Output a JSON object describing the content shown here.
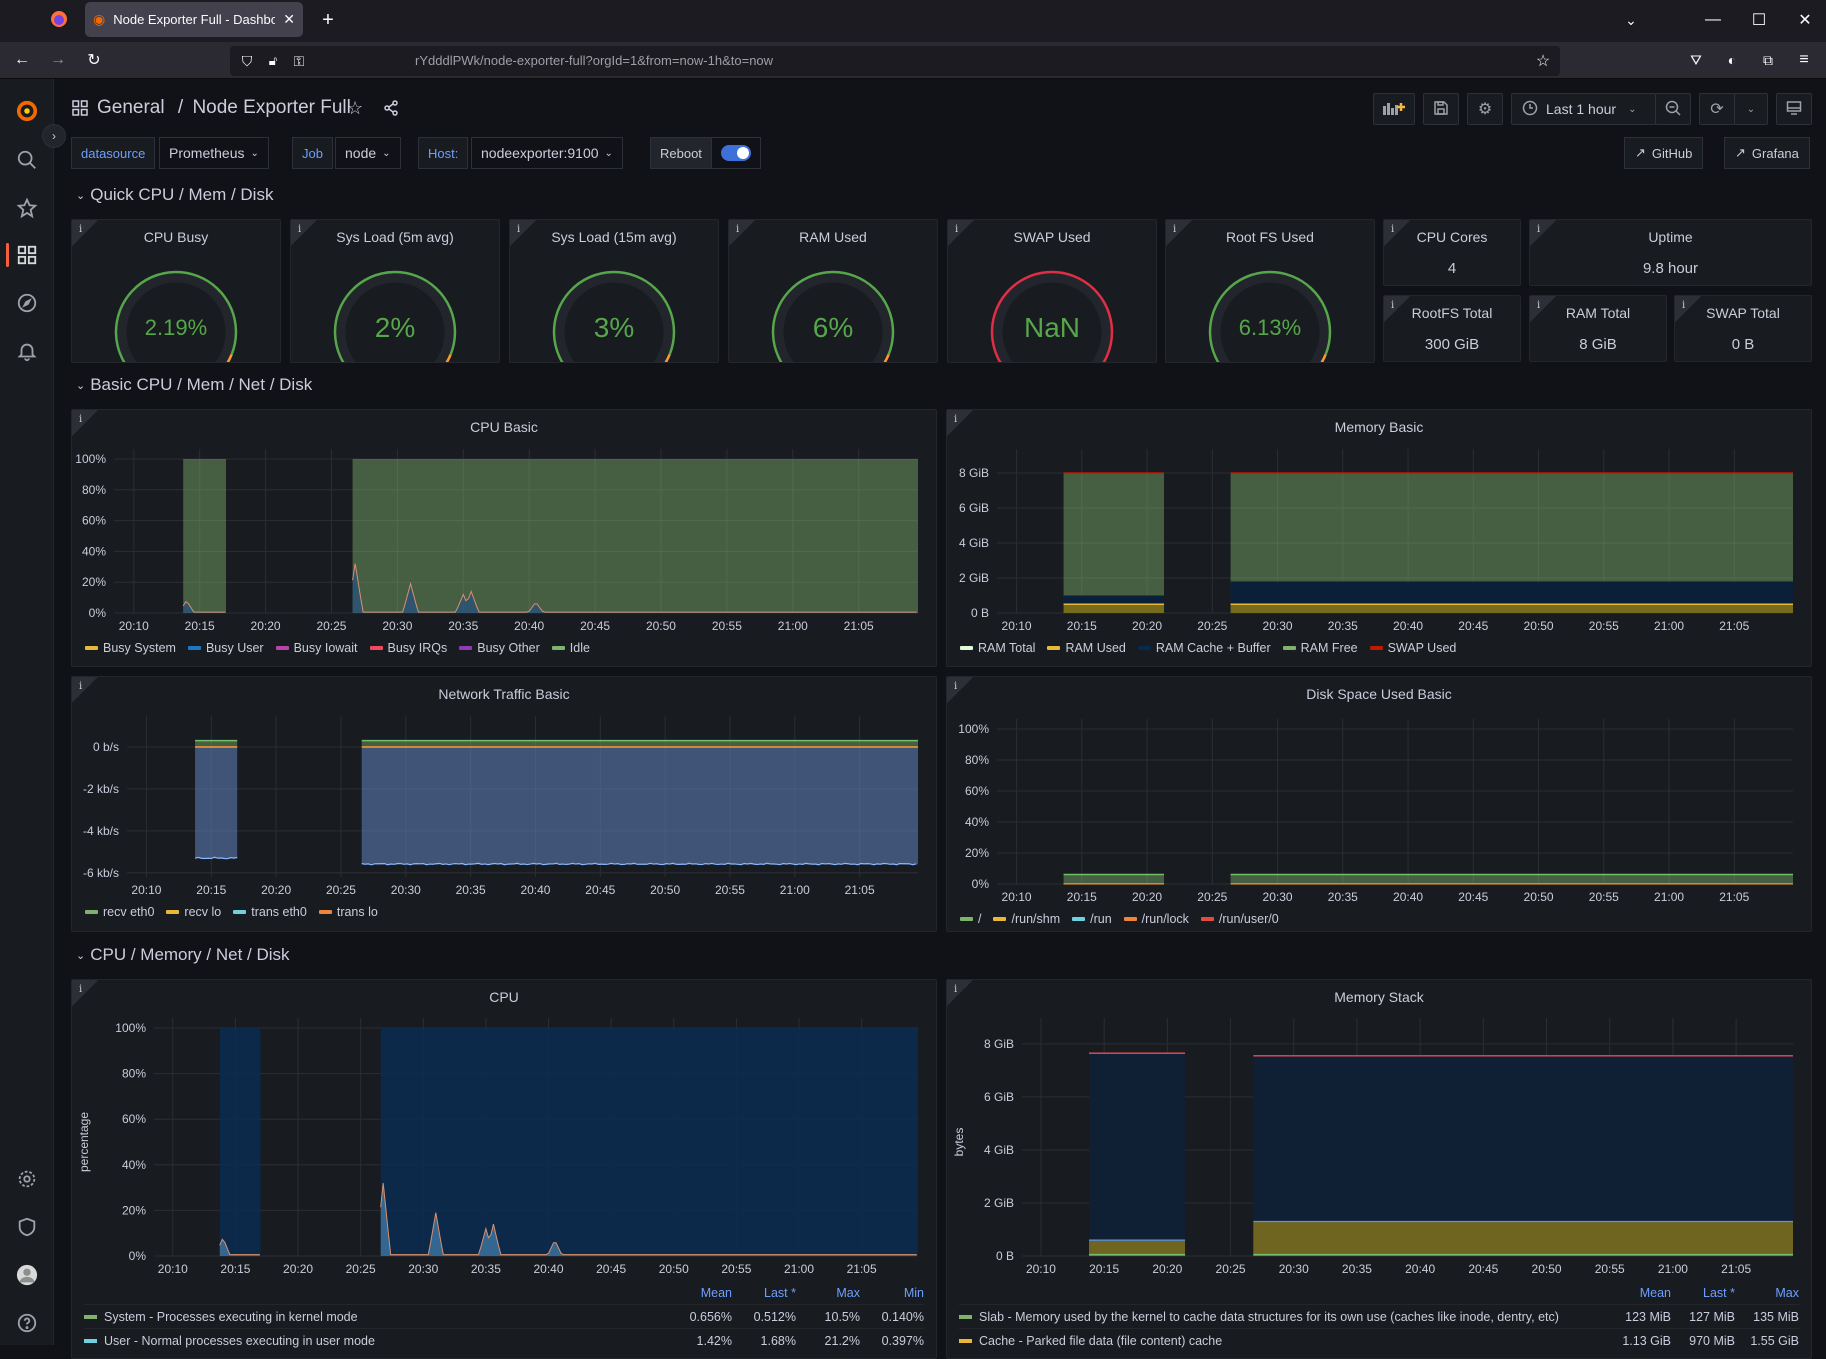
{
  "browser": {
    "tab_title": "Node Exporter Full - Dashboard",
    "url": "rYdddlPWk/node-exporter-full?orgId=1&from=now-1h&to=now"
  },
  "header": {
    "breadcrumb_folder": "General",
    "breadcrumb_sep": "/",
    "dashboard_title": "Node Exporter Full",
    "time_range": "Last 1 hour"
  },
  "variables": [
    {
      "label": "datasource",
      "value": "Prometheus"
    },
    {
      "label": "Job",
      "value": "node"
    },
    {
      "label": "Host:",
      "value": "nodeexporter:9100"
    }
  ],
  "reboot_label": "Reboot",
  "reboot_toggle_on": true,
  "links": [
    {
      "label": "GitHub"
    },
    {
      "label": "Grafana"
    }
  ],
  "rows": [
    "Quick CPU / Mem / Disk",
    "Basic CPU / Mem / Net / Disk",
    "CPU / Memory / Net / Disk"
  ],
  "gauges": [
    {
      "title": "CPU Busy",
      "value": "2.19%",
      "percent": 2.19,
      "thresholds": "green-orange-red"
    },
    {
      "title": "Sys Load (5m avg)",
      "value": "2%",
      "percent": 2,
      "thresholds": "green-orange-red"
    },
    {
      "title": "Sys Load (15m avg)",
      "value": "3%",
      "percent": 3,
      "thresholds": "green-orange-red"
    },
    {
      "title": "RAM Used",
      "value": "6%",
      "percent": 6,
      "thresholds": "green-orange-red"
    },
    {
      "title": "SWAP Used",
      "value": "NaN",
      "percent": 0,
      "thresholds": "green-orange-red-heavy"
    },
    {
      "title": "Root FS Used",
      "value": "6.13%",
      "percent": 6.13,
      "thresholds": "green-orange-red"
    }
  ],
  "stats": [
    {
      "title": "CPU Cores",
      "value": "4"
    },
    {
      "title": "Uptime",
      "value": "9.8 hour"
    },
    {
      "title": "RootFS Total",
      "value": "300 GiB"
    },
    {
      "title": "RAM Total",
      "value": "8 GiB"
    },
    {
      "title": "SWAP Total",
      "value": "0 B"
    }
  ],
  "chart_data": [
    {
      "type": "area",
      "title": "CPU Basic",
      "x": [
        "20:10",
        "20:15",
        "20:20",
        "20:25",
        "20:30",
        "20:35",
        "20:40",
        "20:45",
        "20:50",
        "20:55",
        "21:00",
        "21:05"
      ],
      "yticks": [
        "0%",
        "20%",
        "40%",
        "60%",
        "80%",
        "100%"
      ],
      "ylim": [
        0,
        100
      ],
      "gaps": [
        [
          "20:13:45",
          "20:17:00"
        ],
        [
          "20:26:40",
          "21:09:30"
        ]
      ],
      "series": [
        {
          "name": "Busy System",
          "color": "#EAB839"
        },
        {
          "name": "Busy User",
          "color": "#1F78C1"
        },
        {
          "name": "Busy Iowait",
          "color": "#BA43A9"
        },
        {
          "name": "Busy IRQs",
          "color": "#F2495C"
        },
        {
          "name": "Busy Other",
          "color": "#8F3BB8"
        },
        {
          "name": "Idle",
          "color": "#7EB26D"
        }
      ],
      "spikes": [
        [
          20.45,
          8
        ],
        [
          26.8,
          32
        ],
        [
          31,
          19
        ],
        [
          35,
          12
        ],
        [
          35.6,
          14
        ],
        [
          40.5,
          7
        ]
      ]
    },
    {
      "type": "area",
      "title": "Memory Basic",
      "x": [
        "20:10",
        "20:15",
        "20:20",
        "20:25",
        "20:30",
        "20:35",
        "20:40",
        "20:45",
        "20:50",
        "20:55",
        "21:00",
        "21:05"
      ],
      "yticks": [
        "0 B",
        "2 GiB",
        "4 GiB",
        "6 GiB",
        "8 GiB"
      ],
      "ylim": [
        0,
        8.8
      ],
      "series": [
        {
          "name": "RAM Total",
          "color": "#E0F9D7"
        },
        {
          "name": "RAM Used",
          "color": "#EAB839"
        },
        {
          "name": "RAM Cache + Buffer",
          "color": "#052B51"
        },
        {
          "name": "RAM Free",
          "color": "#7EB26D"
        },
        {
          "name": "SWAP Used",
          "color": "#BF1B00"
        }
      ]
    },
    {
      "type": "area",
      "title": "Network Traffic Basic",
      "x": [
        "20:10",
        "20:15",
        "20:20",
        "20:25",
        "20:30",
        "20:35",
        "20:40",
        "20:45",
        "20:50",
        "20:55",
        "21:00",
        "21:05"
      ],
      "yticks": [
        "-6 kb/s",
        "-4 kb/s",
        "-2 kb/s",
        "0 b/s"
      ],
      "ylim": [
        -6.2,
        1
      ],
      "series": [
        {
          "name": "recv eth0",
          "color": "#7EB26D"
        },
        {
          "name": "recv lo",
          "color": "#EAB839"
        },
        {
          "name": "trans eth0",
          "color": "#6ED0E0"
        },
        {
          "name": "trans lo",
          "color": "#EF843C"
        }
      ]
    },
    {
      "type": "area",
      "title": "Disk Space Used Basic",
      "x": [
        "20:10",
        "20:15",
        "20:20",
        "20:25",
        "20:30",
        "20:35",
        "20:40",
        "20:45",
        "20:50",
        "20:55",
        "21:00",
        "21:05"
      ],
      "yticks": [
        "0%",
        "20%",
        "40%",
        "60%",
        "80%",
        "100%"
      ],
      "ylim": [
        0,
        100
      ],
      "series": [
        {
          "name": "/",
          "color": "#7EB26D"
        },
        {
          "name": "/run/shm",
          "color": "#EAB839"
        },
        {
          "name": "/run",
          "color": "#6ED0E0"
        },
        {
          "name": "/run/lock",
          "color": "#EF843C"
        },
        {
          "name": "/run/user/0",
          "color": "#E24D42"
        }
      ]
    },
    {
      "type": "area",
      "title": "CPU",
      "ylabel": "percentage",
      "x": [
        "20:10",
        "20:15",
        "20:20",
        "20:25",
        "20:30",
        "20:35",
        "20:40",
        "20:45",
        "20:50",
        "20:55",
        "21:00",
        "21:05"
      ],
      "yticks": [
        "0%",
        "20%",
        "40%",
        "60%",
        "80%",
        "100%"
      ],
      "ylim": [
        0,
        100
      ],
      "legend_columns": [
        "Mean",
        "Last *",
        "Max",
        "Min"
      ],
      "legend_rows": [
        {
          "name": "System - Processes executing in kernel mode",
          "color": "#7EB26D",
          "values": [
            "0.656%",
            "0.512%",
            "10.5%",
            "0.140%"
          ]
        },
        {
          "name": "User - Normal processes executing in user mode",
          "color": "#6ED0E0",
          "values": [
            "1.42%",
            "1.68%",
            "21.2%",
            "0.397%"
          ]
        }
      ]
    },
    {
      "type": "area",
      "title": "Memory Stack",
      "ylabel": "bytes",
      "x": [
        "20:10",
        "20:15",
        "20:20",
        "20:25",
        "20:30",
        "20:35",
        "20:40",
        "20:45",
        "20:50",
        "20:55",
        "21:00",
        "21:05"
      ],
      "yticks": [
        "0 B",
        "2 GiB",
        "4 GiB",
        "6 GiB",
        "8 GiB"
      ],
      "ylim": [
        0,
        8.6
      ],
      "legend_columns": [
        "Mean",
        "Last *",
        "Max"
      ],
      "legend_rows": [
        {
          "name": "Slab - Memory used by the kernel to cache data structures for its own use (caches like inode, dentry, etc)",
          "color": "#7EB26D",
          "values": [
            "123 MiB",
            "127 MiB",
            "135 MiB"
          ]
        },
        {
          "name": "Cache - Parked file data (file content) cache",
          "color": "#EAB839",
          "values": [
            "1.13 GiB",
            "970 MiB",
            "1.55 GiB"
          ]
        }
      ]
    }
  ]
}
